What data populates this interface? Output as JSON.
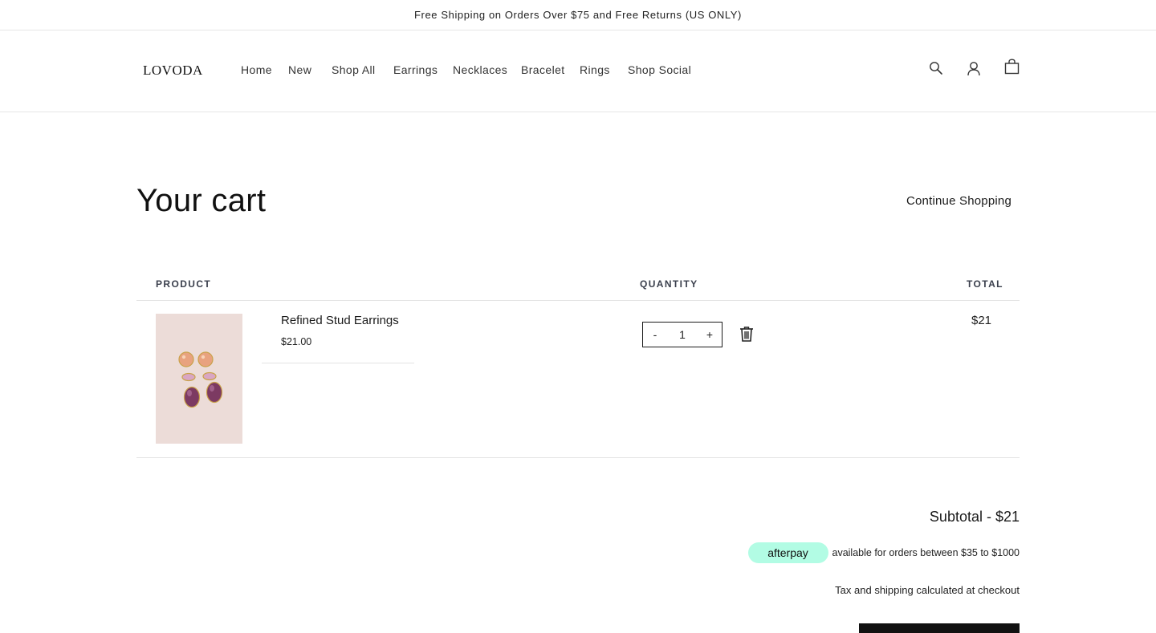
{
  "announcement": "Free Shipping on Orders Over $75 and Free Returns (US ONLY)",
  "logo": "LOVODA",
  "nav": {
    "home": "Home",
    "new": "New",
    "shop_all": "Shop All",
    "earrings": "Earrings",
    "necklaces": "Necklaces",
    "bracelet": "Bracelet",
    "rings": "Rings",
    "shop_social": "Shop Social"
  },
  "header_icons": [
    "search-icon",
    "account-icon",
    "cart-bag-icon"
  ],
  "cart": {
    "title": "Your cart",
    "continue_label": "Continue Shopping",
    "columns": {
      "product": "PRODUCT",
      "quantity": "QUANTITY",
      "total": "TOTAL"
    },
    "items": [
      {
        "name": "Refined Stud Earrings",
        "price": "$21.00",
        "quantity": "1",
        "total": "$21",
        "decrement_label": "-",
        "increment_label": "+"
      }
    ]
  },
  "summary": {
    "subtotal": "Subtotal - $21",
    "afterpay_label": "afterpay",
    "afterpay_text": "available for orders between $35 to $1000",
    "tax_note": "Tax and shipping calculated at checkout"
  },
  "colors": {
    "afterpay_mint": "#b2fce4",
    "checkout_button": "#111111"
  }
}
